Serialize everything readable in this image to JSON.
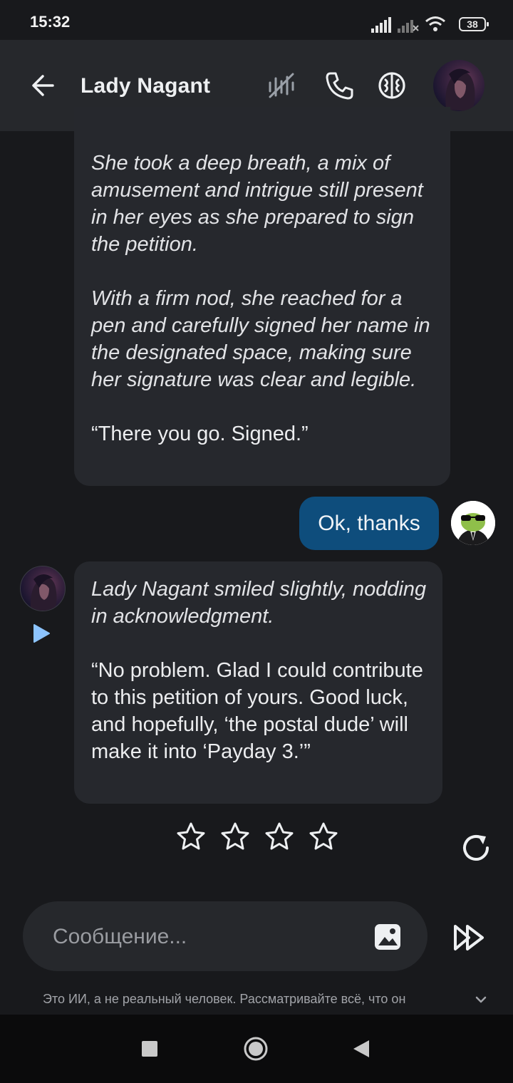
{
  "status_bar": {
    "time": "15:32",
    "battery": "38"
  },
  "header": {
    "character_name": "Lady Nagant"
  },
  "messages": [
    {
      "role": "character",
      "paragraphs": [
        {
          "style": "italic",
          "text": "She took a deep breath, a mix of amusement and intrigue still present in her eyes as she prepared to sign the petition."
        },
        {
          "style": "italic",
          "text": "With a firm nod, she reached for a pen and carefully signed her name in the designated space, making sure her signature was clear and legible."
        },
        {
          "style": "normal",
          "text": "“There you go. Signed.”"
        }
      ]
    },
    {
      "role": "user",
      "text": "Ok, thanks"
    },
    {
      "role": "character",
      "paragraphs": [
        {
          "style": "italic",
          "text": "Lady Nagant smiled slightly, nodding in acknowledgment."
        },
        {
          "style": "normal",
          "text": "“No problem. Glad I could contribute to this petition of yours. Good luck, and hopefully, ‘the postal dude’ will make it into ‘Payday 3.’”"
        }
      ]
    }
  ],
  "rating": {
    "stars_total": 4,
    "stars_selected": 0
  },
  "composer": {
    "placeholder": "Сообщение..."
  },
  "disclaimer": "Это ИИ, а не реальный человек. Рассматривайте всё, что он",
  "icons": {
    "back": "arrow-left-icon",
    "mute": "muted-audio-icon",
    "call": "phone-icon",
    "brain": "brain-icon",
    "play": "play-icon",
    "star": "star-outline-icon",
    "regenerate": "regenerate-icon",
    "image": "image-icon",
    "send": "fast-forward-send-icon",
    "expand": "chevron-down-icon"
  },
  "colors": {
    "background": "#18191c",
    "app_bar": "#26282c",
    "bubble": "#26282d",
    "user_bubble": "#0e4d7c",
    "play_accent": "#8cc4ff"
  }
}
